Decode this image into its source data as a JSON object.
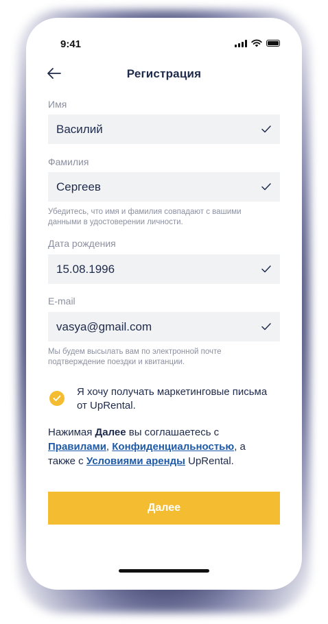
{
  "status": {
    "time": "9:41"
  },
  "header": {
    "title": "Регистрация"
  },
  "form": {
    "first_name": {
      "label": "Имя",
      "value": "Василий"
    },
    "last_name": {
      "label": "Фамилия",
      "value": "Сергеев"
    },
    "name_hint": "Убедитесь, что имя и фамилия совпадают с вашими данными в удостоверении личности.",
    "birth_date": {
      "label": "Дата рождения",
      "value": "15.08.1996"
    },
    "email": {
      "label": "E-mail",
      "value": "vasya@gmail.com"
    },
    "email_hint": "Мы будем высылать вам по электронной почте подтверждение поездки и квитанции."
  },
  "marketing": {
    "text": "Я хочу получать маркетинговые письма от UpRental.",
    "checked": true
  },
  "agreement": {
    "prefix": "Нажимая ",
    "bold": "Далее",
    "mid1": " вы соглашаетесь с ",
    "link_rules": "Правилами",
    "comma": ", ",
    "link_privacy": "Конфиденциальностью",
    "mid2": ", а также с ",
    "link_terms": "Условиями аренды",
    "suffix": " UpRental."
  },
  "actions": {
    "next_label": "Далее"
  },
  "colors": {
    "accent": "#f4bd31",
    "text": "#1e2a4a",
    "link": "#1e5aa8",
    "field_bg": "#f1f2f4"
  }
}
